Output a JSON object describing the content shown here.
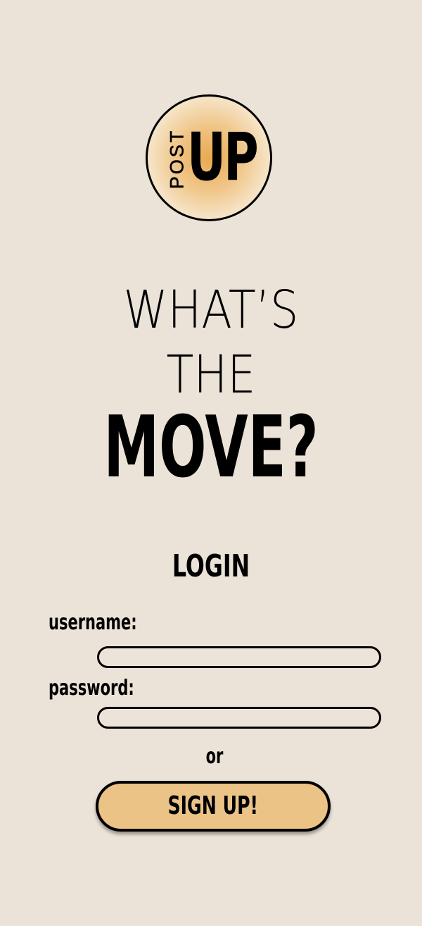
{
  "logo": {
    "post_text": "POST",
    "up_text": "UP"
  },
  "headline": {
    "line1": "WHAT’S",
    "line2": "THE",
    "line3": "MOVE?"
  },
  "login": {
    "title": "LOGIN",
    "username_label": "username:",
    "username_value": "",
    "password_label": "password:",
    "password_value": "",
    "or_text": "or",
    "signup_label": "SIGN UP!"
  },
  "colors": {
    "background": "#ebe3d8",
    "accent": "#ecc386",
    "logo_center": "#e9a94f",
    "text": "#000000"
  }
}
